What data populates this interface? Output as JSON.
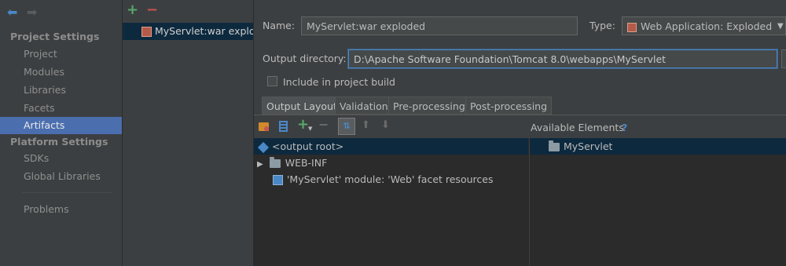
{
  "nav": {
    "back_icon": "arrow-left",
    "forward_icon": "arrow-right",
    "sections": [
      {
        "title": "Project Settings",
        "items": [
          "Project",
          "Modules",
          "Libraries",
          "Facets",
          "Artifacts"
        ]
      },
      {
        "title": "Platform Settings",
        "items": [
          "SDKs",
          "Global Libraries"
        ]
      }
    ],
    "selected": "Artifacts",
    "problems": "Problems"
  },
  "artifacts": {
    "add_icon": "plus",
    "remove_icon": "minus",
    "items": [
      "MyServlet:war exploded"
    ]
  },
  "form": {
    "name_label": "Name:",
    "name_value": "MyServlet:war exploded",
    "type_label": "Type:",
    "type_value": "Web Application: Exploded",
    "output_label": "Output directory:",
    "output_value": "D:\\Apache Software Foundation\\Tomcat 8.0\\webapps\\MyServlet",
    "include_label": "Include in project build",
    "include_checked": false
  },
  "tabs": [
    "Output Layout",
    "Validation",
    "Pre-processing",
    "Post-processing"
  ],
  "selected_tab": "Output Layout",
  "layout": {
    "available_label": "Available Elements",
    "help": "?",
    "tree": [
      "<output root>",
      "WEB-INF",
      "'MyServlet' module: 'Web' facet resources"
    ],
    "available": [
      "MyServlet"
    ]
  },
  "colors": {
    "background": "#3c3f41",
    "selection": "#4b6eaf",
    "tree_background": "#2b2b2b",
    "add_green": "#59a869",
    "remove_red": "#c75450"
  }
}
